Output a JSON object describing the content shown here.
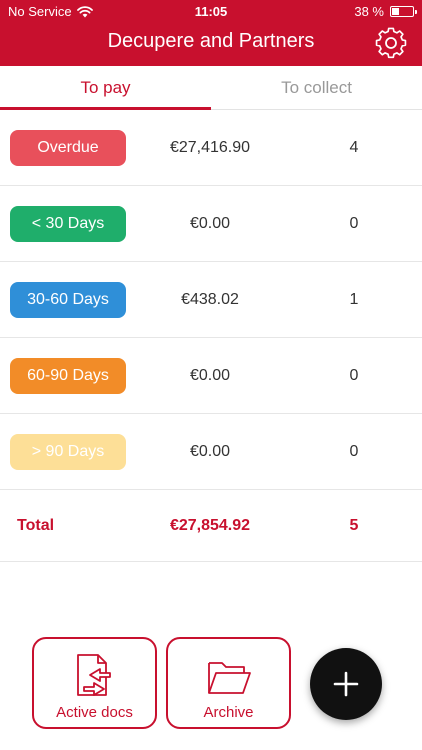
{
  "status_bar": {
    "carrier": "No Service",
    "time": "11:05",
    "battery_text": "38 %",
    "battery_level": 0.38,
    "icons": [
      "wifi-icon",
      "battery-icon"
    ]
  },
  "header": {
    "title": "Decupere and Partners",
    "settings_icon": "gear-icon"
  },
  "tabs": [
    {
      "label": "To pay",
      "active": true
    },
    {
      "label": "To collect",
      "active": false
    }
  ],
  "rows": [
    {
      "label": "Overdue",
      "amount": "€27,416.90",
      "count": "4",
      "color": "#e8505b"
    },
    {
      "label": "< 30 Days",
      "amount": "€0.00",
      "count": "0",
      "color": "#1fae6b"
    },
    {
      "label": "30-60 Days",
      "amount": "€438.02",
      "count": "1",
      "color": "#2f8fd8"
    },
    {
      "label": "60-90 Days",
      "amount": "€0.00",
      "count": "0",
      "color": "#f28c28"
    },
    {
      "label": "> 90 Days",
      "amount": "€0.00",
      "count": "0",
      "color": "#fddf97"
    }
  ],
  "total": {
    "label": "Total",
    "amount": "€27,854.92",
    "count": "5"
  },
  "actions": [
    {
      "label": "Active docs",
      "icon": "active-docs-icon"
    },
    {
      "label": "Archive",
      "icon": "folder-icon"
    }
  ],
  "fab": {
    "icon": "plus-icon"
  },
  "colors": {
    "brand": "#c8102e",
    "fab": "#111111"
  }
}
